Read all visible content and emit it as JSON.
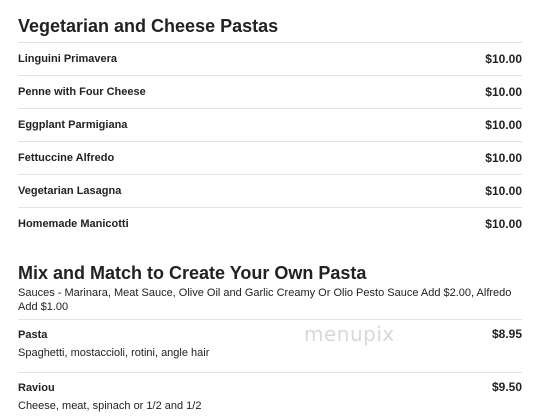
{
  "section1": {
    "title": "Vegetarian and Cheese Pastas",
    "items": [
      {
        "name": "Linguini Primavera",
        "price": "$10.00"
      },
      {
        "name": "Penne with Four Cheese",
        "price": "$10.00"
      },
      {
        "name": "Eggplant Parmigiana",
        "price": "$10.00"
      },
      {
        "name": "Fettuccine Alfredo",
        "price": "$10.00"
      },
      {
        "name": "Vegetarian Lasagna",
        "price": "$10.00"
      },
      {
        "name": "Homemade Manicotti",
        "price": "$10.00"
      }
    ]
  },
  "section2": {
    "title": "Mix and Match to Create Your Own Pasta",
    "description": "Sauces - Marinara, Meat Sauce, Olive Oil and Garlic Creamy Or Olio Pesto Sauce Add $2.00, Alfredo Add $1.00",
    "items": [
      {
        "name": "Pasta",
        "price": "$8.95",
        "description": "Spaghetti, mostaccioli, rotini, angle hair"
      },
      {
        "name": "Raviou",
        "price": "$9.50",
        "description": "Cheese, meat, spinach or 1/2 and 1/2"
      }
    ]
  },
  "watermark": "menupix"
}
